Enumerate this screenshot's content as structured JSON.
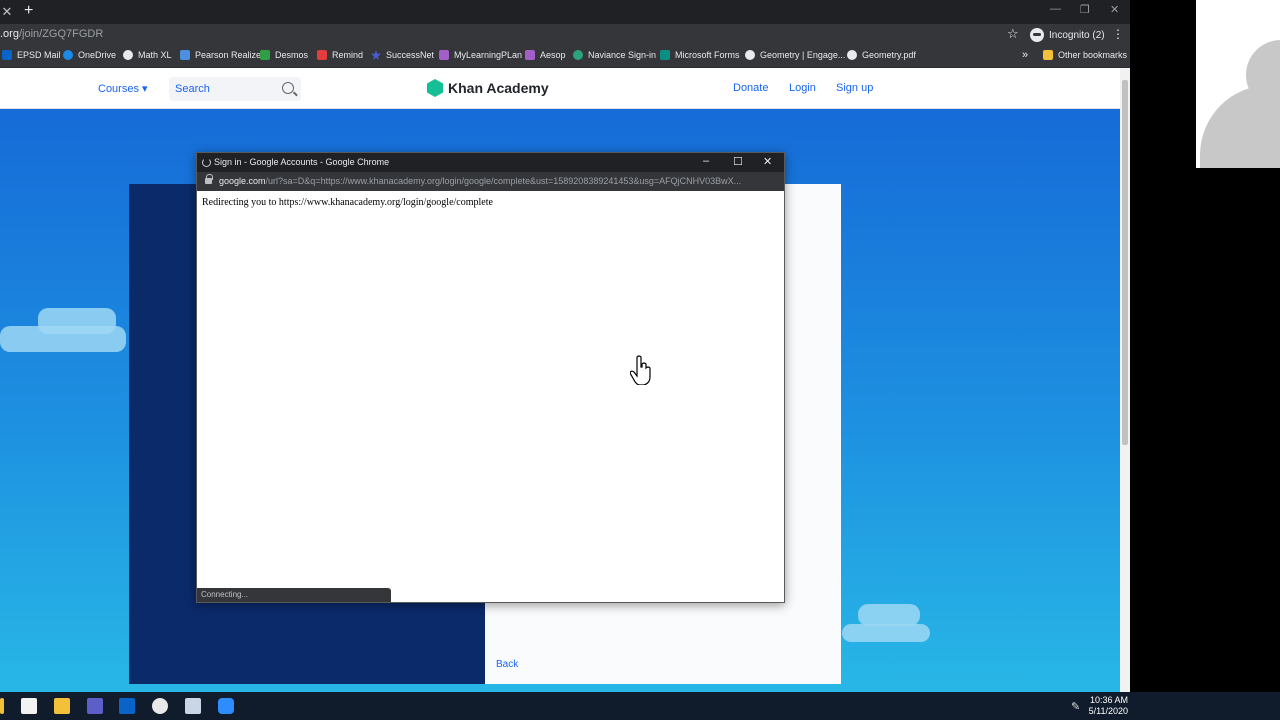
{
  "browser": {
    "url_domain": ".org",
    "url_path": "/join/ZGQ7FGDR",
    "incognito_label": "Incognito (2)",
    "new_tab_glyph": "+",
    "close_tab_glyph": "✕"
  },
  "bookmarks": [
    {
      "label": "EPSD Mail",
      "color": "#0a64c8"
    },
    {
      "label": "OneDrive",
      "color": "#1a8ae6"
    },
    {
      "label": "Math XL",
      "color": "#e8eaed"
    },
    {
      "label": "Pearson Realize",
      "color": "#4b8fe0"
    },
    {
      "label": "Desmos",
      "color": "#2f9e44"
    },
    {
      "label": "Remind",
      "color": "#e23c3c"
    },
    {
      "label": "SuccessNet",
      "color": "#4c5bd4"
    },
    {
      "label": "MyLearningPLan",
      "color": "#a45ec8"
    },
    {
      "label": "Aesop",
      "color": "#a45ec8"
    },
    {
      "label": "Naviance Sign-in",
      "color": "#2aa37a"
    },
    {
      "label": "Microsoft Forms",
      "color": "#0b8f85"
    },
    {
      "label": "Geometry | Engage...",
      "color": "#e8eaed"
    },
    {
      "label": "Geometry.pdf",
      "color": "#e8eaed"
    }
  ],
  "other_bookmarks": "Other bookmarks",
  "site": {
    "courses": "Courses ▾",
    "search_placeholder": "Search",
    "logo": "Khan Academy",
    "donate": "Donate",
    "login": "Login",
    "signup": "Sign up",
    "back": "Back"
  },
  "popup": {
    "title": "Sign in - Google Accounts - Google Chrome",
    "url_domain": "google.com",
    "url_rest": "/url?sa=D&q=https://www.khanacademy.org/login/google/complete&ust=1589208389241453&usg=AFQjCNHV03BwX...",
    "message": "Redirecting you to https://www.khanacademy.org/login/google/complete",
    "status": "Connecting..."
  },
  "taskbar": {
    "time": "10:36 AM",
    "date": "5/11/2020",
    "apps": [
      {
        "name": "store",
        "color": "#f2f2f2"
      },
      {
        "name": "files",
        "color": "#f3c03a"
      },
      {
        "name": "teams",
        "color": "#5b5fc7"
      },
      {
        "name": "outlook",
        "color": "#0a64c8"
      },
      {
        "name": "snip",
        "color": "#e8e8e8"
      },
      {
        "name": "news",
        "color": "#c9d6e8"
      },
      {
        "name": "zoom",
        "color": "#2d8cff"
      }
    ]
  },
  "colors": {
    "accent": "#1865f2",
    "logo_green": "#14bf96",
    "card_dark": "#0b2a6a"
  }
}
